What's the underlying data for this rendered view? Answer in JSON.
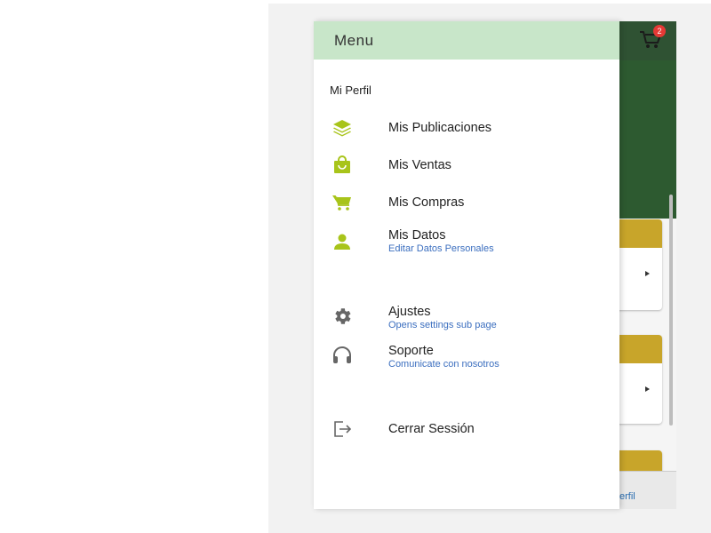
{
  "drawer": {
    "title": "Menu",
    "profile_label": "Mi Perfil",
    "items": [
      {
        "label": "Mis Publicaciones",
        "sub": "",
        "icon": "layers-icon"
      },
      {
        "label": "Mis Ventas",
        "sub": "",
        "icon": "shopping-bag-icon"
      },
      {
        "label": "Mis Compras",
        "sub": "",
        "icon": "cart-icon"
      },
      {
        "label": "Mis Datos",
        "sub": "Editar Datos Personales",
        "icon": "person-icon"
      },
      {
        "label": "Ajustes",
        "sub": "Opens settings sub page",
        "icon": "gear-icon"
      },
      {
        "label": "Soporte",
        "sub": "Comunicate con nosotros",
        "icon": "headset-icon"
      },
      {
        "label": "Cerrar Sessión",
        "sub": "",
        "icon": "logout-icon"
      }
    ]
  },
  "app": {
    "cart_badge": "2",
    "bottom_label_partial": "erfil"
  },
  "colors": {
    "drawer_header": "#c8e6c9",
    "icon_green": "#a8c41a",
    "icon_gray": "#666666",
    "sub_text": "#3c6fbf",
    "app_header": "#2f5233",
    "card_bar": "#c8a52a",
    "badge": "#e53935"
  }
}
